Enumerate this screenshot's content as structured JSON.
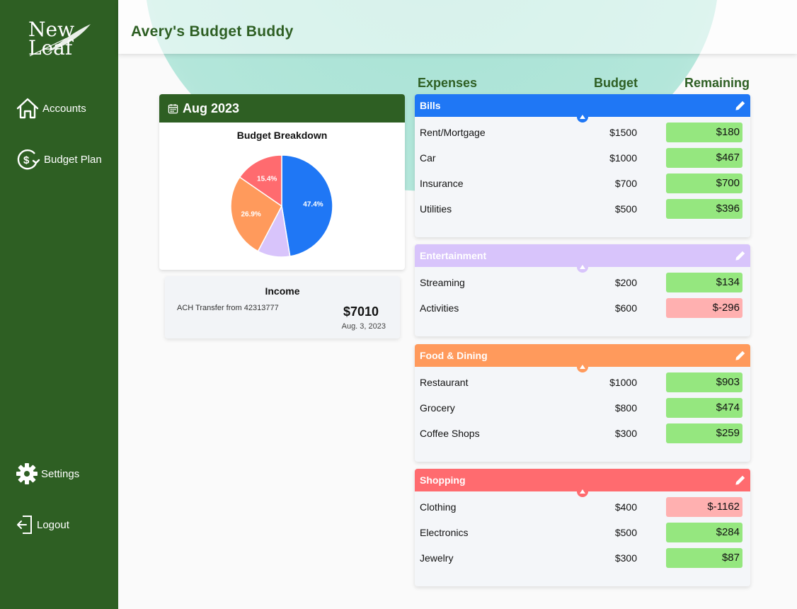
{
  "logo": {
    "line1": "New",
    "line2": "Leaf"
  },
  "sidebar": {
    "items": [
      {
        "label": "Accounts",
        "icon": "home-icon"
      },
      {
        "label": "Budget Plan",
        "icon": "dollar-cycle-icon"
      },
      {
        "label": "Settings",
        "icon": "gear-icon"
      },
      {
        "label": "Logout",
        "icon": "logout-icon"
      }
    ]
  },
  "header": {
    "title": "Avery's Budget Buddy"
  },
  "month": {
    "label": "Aug 2023",
    "icon": "calendar-icon"
  },
  "chart_data": {
    "type": "pie",
    "title": "Budget Breakdown",
    "slices": [
      {
        "label": "47.4%",
        "value": 47.4,
        "color": "#1f77f5"
      },
      {
        "label": "",
        "value": 10.3,
        "color": "#d8c4fb"
      },
      {
        "label": "26.9%",
        "value": 26.9,
        "color": "#ff9a5c"
      },
      {
        "label": "15.4%",
        "value": 15.4,
        "color": "#ff6b6f"
      }
    ]
  },
  "income": {
    "title": "Income",
    "description": "ACH Transfer from 42313777",
    "amount": "$7010",
    "date": "Aug. 3, 2023"
  },
  "expenses": {
    "headers": {
      "expenses": "Expenses",
      "budget": "Budget",
      "remaining": "Remaining"
    },
    "categories": [
      {
        "name": "Bills",
        "color": "#1f77f5",
        "items": [
          {
            "name": "Rent/Mortgage",
            "budget": "$1500",
            "remaining": "$180",
            "negative": false
          },
          {
            "name": "Car",
            "budget": "$1000",
            "remaining": "$467",
            "negative": false
          },
          {
            "name": "Insurance",
            "budget": "$700",
            "remaining": "$700",
            "negative": false
          },
          {
            "name": "Utilities",
            "budget": "$500",
            "remaining": "$396",
            "negative": false
          }
        ]
      },
      {
        "name": "Entertainment",
        "color": "#d8c4fb",
        "items": [
          {
            "name": "Streaming",
            "budget": "$200",
            "remaining": "$134",
            "negative": false
          },
          {
            "name": "Activities",
            "budget": "$600",
            "remaining": "$-296",
            "negative": true
          }
        ]
      },
      {
        "name": "Food & Dining",
        "color": "#ff9a5c",
        "items": [
          {
            "name": "Restaurant",
            "budget": "$1000",
            "remaining": "$903",
            "negative": false
          },
          {
            "name": "Grocery",
            "budget": "$800",
            "remaining": "$474",
            "negative": false
          },
          {
            "name": "Coffee Shops",
            "budget": "$300",
            "remaining": "$259",
            "negative": false
          }
        ]
      },
      {
        "name": "Shopping",
        "color": "#ff6b6f",
        "items": [
          {
            "name": "Clothing",
            "budget": "$400",
            "remaining": "$-1162",
            "negative": true
          },
          {
            "name": "Electronics",
            "budget": "$500",
            "remaining": "$284",
            "negative": false
          },
          {
            "name": "Jewelry",
            "budget": "$300",
            "remaining": "$87",
            "negative": false
          }
        ]
      }
    ]
  }
}
